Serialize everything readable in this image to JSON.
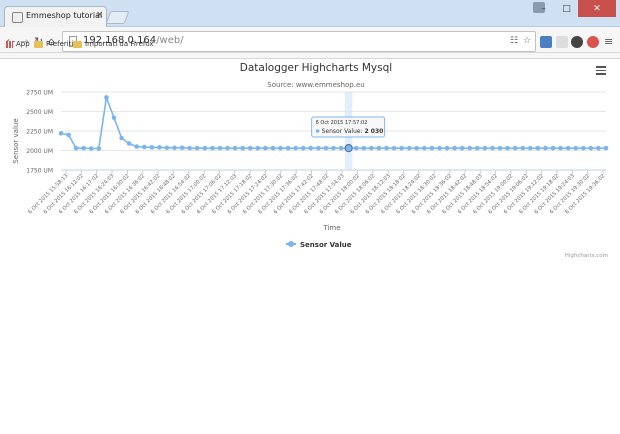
{
  "browser": {
    "tab_title": "Emmeshop tutorial",
    "tab_close": "×",
    "url_host": "192.168.0.164",
    "url_path": "/web/",
    "window_buttons": [
      "–",
      "□",
      "✕"
    ]
  },
  "bookmarks": {
    "apps": "App",
    "items": [
      "Preferiti",
      "Importati da Firefox"
    ]
  },
  "chart_data": {
    "type": "line",
    "title": "Datalogger Highcharts Mysql",
    "subtitle": "Source: www.emmeshop.eu",
    "xlabel": "Time",
    "ylabel": "Sensor value",
    "credits": "Highcharts.com",
    "ylim": [
      1750,
      2750
    ],
    "yticks": [
      "1750 UM",
      "2000 UM",
      "2250 UM",
      "2500 UM",
      "2750 UM"
    ],
    "ytick_values": [
      1750,
      2000,
      2250,
      2500,
      2750
    ],
    "grid": true,
    "legend_position": "bottom-center",
    "color": "#7cb5ec",
    "series": [
      {
        "name": "Sensor Value",
        "values": [
          2220,
          2200,
          2030,
          2030,
          2025,
          2025,
          2680,
          2420,
          2160,
          2090,
          2050,
          2045,
          2040,
          2040,
          2035,
          2035,
          2035,
          2030,
          2030,
          2030,
          2030,
          2030,
          2030,
          2030,
          2030,
          2030,
          2030,
          2030,
          2030,
          2030,
          2030,
          2030,
          2030,
          2030,
          2030,
          2030,
          2030,
          2030,
          2030,
          2030,
          2030,
          2030,
          2030,
          2030,
          2030,
          2030,
          2030,
          2030,
          2030,
          2030,
          2030,
          2030,
          2030,
          2030,
          2030,
          2030,
          2030,
          2030,
          2030,
          2030,
          2030,
          2030,
          2030,
          2030,
          2030,
          2030,
          2030,
          2030,
          2030,
          2030,
          2030,
          2030,
          2030
        ]
      }
    ],
    "xtick_labels": [
      "6 Oct 2015 15:58:13",
      "6 Oct 2015 16:12:02",
      "6 Oct 2015 16:17:02",
      "6 Oct 2015 16:24:03",
      "6 Oct 2015 16:30:02",
      "6 Oct 2015 16:36:02",
      "6 Oct 2015 16:42:02",
      "6 Oct 2015 16:48:02",
      "6 Oct 2015 16:54:02",
      "6 Oct 2015 17:00:02",
      "6 Oct 2015 17:06:02",
      "6 Oct 2015 17:12:03",
      "6 Oct 2015 17:18:02",
      "6 Oct 2015 17:24:02",
      "6 Oct 2015 17:30:02",
      "6 Oct 2015 17:36:02",
      "6 Oct 2015 17:42:02",
      "6 Oct 2015 17:48:02",
      "6 Oct 2015 17:54:03",
      "6 Oct 2015 18:00:02",
      "6 Oct 2015 18:06:02",
      "6 Oct 2015 18:12:03",
      "6 Oct 2015 18:18:02",
      "6 Oct 2015 18:24:02",
      "6 Oct 2015 18:30:02",
      "6 Oct 2015 18:36:02",
      "6 Oct 2015 18:42:02",
      "6 Oct 2015 18:48:03",
      "6 Oct 2015 18:54:02",
      "6 Oct 2015 19:00:02",
      "6 Oct 2015 19:06:02",
      "6 Oct 2015 19:12:02",
      "6 Oct 2015 19:18:02",
      "6 Oct 2015 19:24:03",
      "6 Oct 2015 19:30:02",
      "6 Oct 2015 19:36:02"
    ],
    "tooltip": {
      "date": "6 Oct 2015 17:57:02",
      "series_label": "Sensor Value:",
      "value": "2 030",
      "point_index": 38
    }
  }
}
